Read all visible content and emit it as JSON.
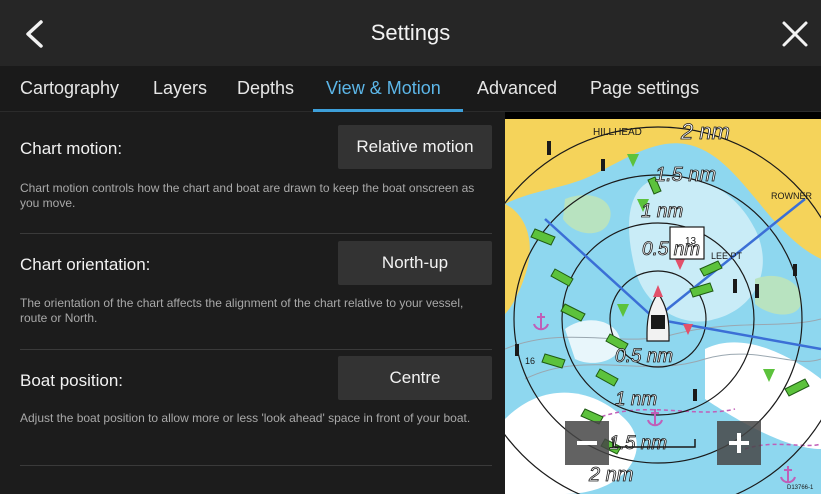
{
  "header": {
    "title": "Settings",
    "back_icon": "chevron-left-icon",
    "close_icon": "close-icon"
  },
  "tabs": [
    {
      "label": "Cartography",
      "active": false
    },
    {
      "label": "Layers",
      "active": false
    },
    {
      "label": "Depths",
      "active": false
    },
    {
      "label": "View & Motion",
      "active": true
    },
    {
      "label": "Advanced",
      "active": false
    },
    {
      "label": "Page settings",
      "active": false
    }
  ],
  "settings": {
    "chart_motion": {
      "label": "Chart motion:",
      "value": "Relative motion",
      "description": "Chart motion controls how the chart and boat are drawn to keep the boat onscreen as you move."
    },
    "chart_orientation": {
      "label": "Chart orientation:",
      "value": "North-up",
      "description": "The orientation of the chart affects the alignment of the chart relative to your vessel, route or North."
    },
    "boat_position": {
      "label": "Boat position:",
      "value": "Centre",
      "description": "Adjust the boat position to allow more or less 'look ahead' space in front of your boat."
    }
  },
  "map": {
    "place_labels": [
      "HILLHEAD",
      "ROWNER",
      "LEE PT"
    ],
    "range_labels": [
      "2 nm",
      "1.5 nm",
      "1 nm",
      "0.5 nm",
      "0.5 nm",
      "1 nm",
      "1.5 nm",
      "2 nm"
    ],
    "depth_labels": [
      "13",
      "16"
    ],
    "corner_code": "D13766-1",
    "zoom_out_icon": "minus-icon",
    "zoom_in_icon": "plus-icon",
    "colors": {
      "land": "#f5d35a",
      "shallow": "#8ed7ef",
      "deep": "#ffffff",
      "range_ring": "#1a1a1a",
      "vessel_target": "#5cc23c"
    }
  },
  "colors": {
    "accent": "#3d9fd9",
    "background": "#1c1c1c",
    "header": "#262626"
  }
}
